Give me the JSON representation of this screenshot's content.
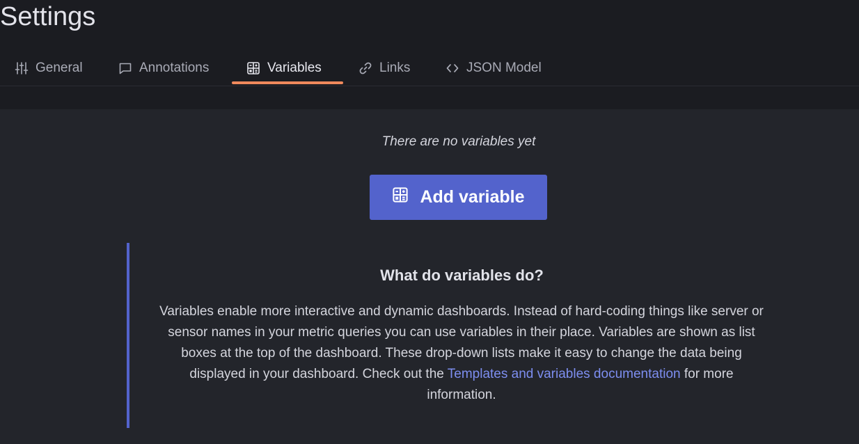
{
  "page": {
    "title": "Settings"
  },
  "tabs": [
    {
      "label": "General",
      "icon": "sliders-icon",
      "active": false
    },
    {
      "label": "Annotations",
      "icon": "comment-icon",
      "active": false
    },
    {
      "label": "Variables",
      "icon": "calculator-icon",
      "active": true
    },
    {
      "label": "Links",
      "icon": "link-icon",
      "active": false
    },
    {
      "label": "JSON Model",
      "icon": "code-brackets-icon",
      "active": false
    }
  ],
  "empty_state": {
    "message": "There are no variables yet",
    "add_button_label": "Add variable",
    "add_button_icon": "calculator-icon"
  },
  "info": {
    "title": "What do variables do?",
    "body_before_link": "Variables enable more interactive and dynamic dashboards. Instead of hard-coding things like server or sensor names in your metric queries you can use variables in their place. Variables are shown as list boxes at the top of the dashboard. These drop-down lists make it easy to change the data being displayed in your dashboard. Check out the ",
    "link_text": "Templates and variables documentation",
    "body_after_link": " for more information."
  },
  "colors": {
    "accent_tab_underline": "#f0895c",
    "primary_button": "#5363cc",
    "link": "#7d8ef0"
  }
}
